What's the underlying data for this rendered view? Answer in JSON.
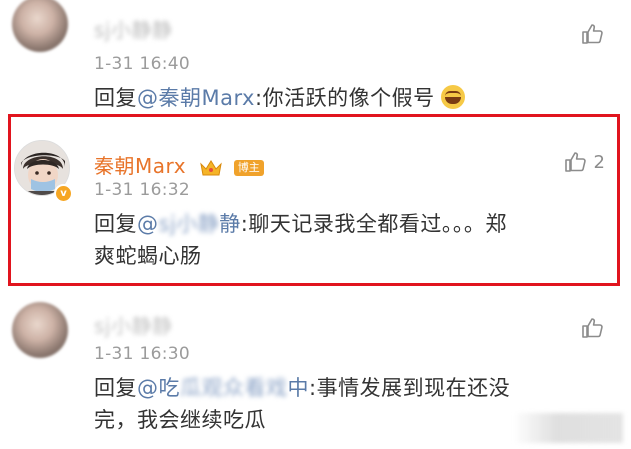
{
  "comments": [
    {
      "name": "sj小静静",
      "time": "1-31 16:40",
      "reply_prefix": "回复",
      "mention": "@秦朝Marx",
      "text": ":你活跃的像个假号",
      "emoji": "laughing-crying-emoji",
      "likes": ""
    },
    {
      "name": "秦朝Marx",
      "badge": "博主",
      "time": "1-31 16:32",
      "reply_prefix": "回复",
      "mention_visible": "@",
      "mention_blurred": "sj小静",
      "mention_end": "静",
      "text_line1": ":聊天记录我全都看过。。。郑",
      "text_line2": "爽蛇蝎心肠",
      "likes": "2"
    },
    {
      "name": "sj小静静",
      "time": "1-31 16:30",
      "reply_prefix": "回复",
      "mention_visible": "@吃",
      "mention_blurred": "瓜观众看戏",
      "mention_end": "中",
      "text_line1": ":事情发展到现在还没",
      "text_line2": "完，我会继续吃瓜",
      "likes": ""
    }
  ],
  "colors": {
    "link": "#5b7ba8",
    "highlight_border": "#e1141e",
    "badge": "#f0a22b",
    "time": "#9b9b9b"
  }
}
